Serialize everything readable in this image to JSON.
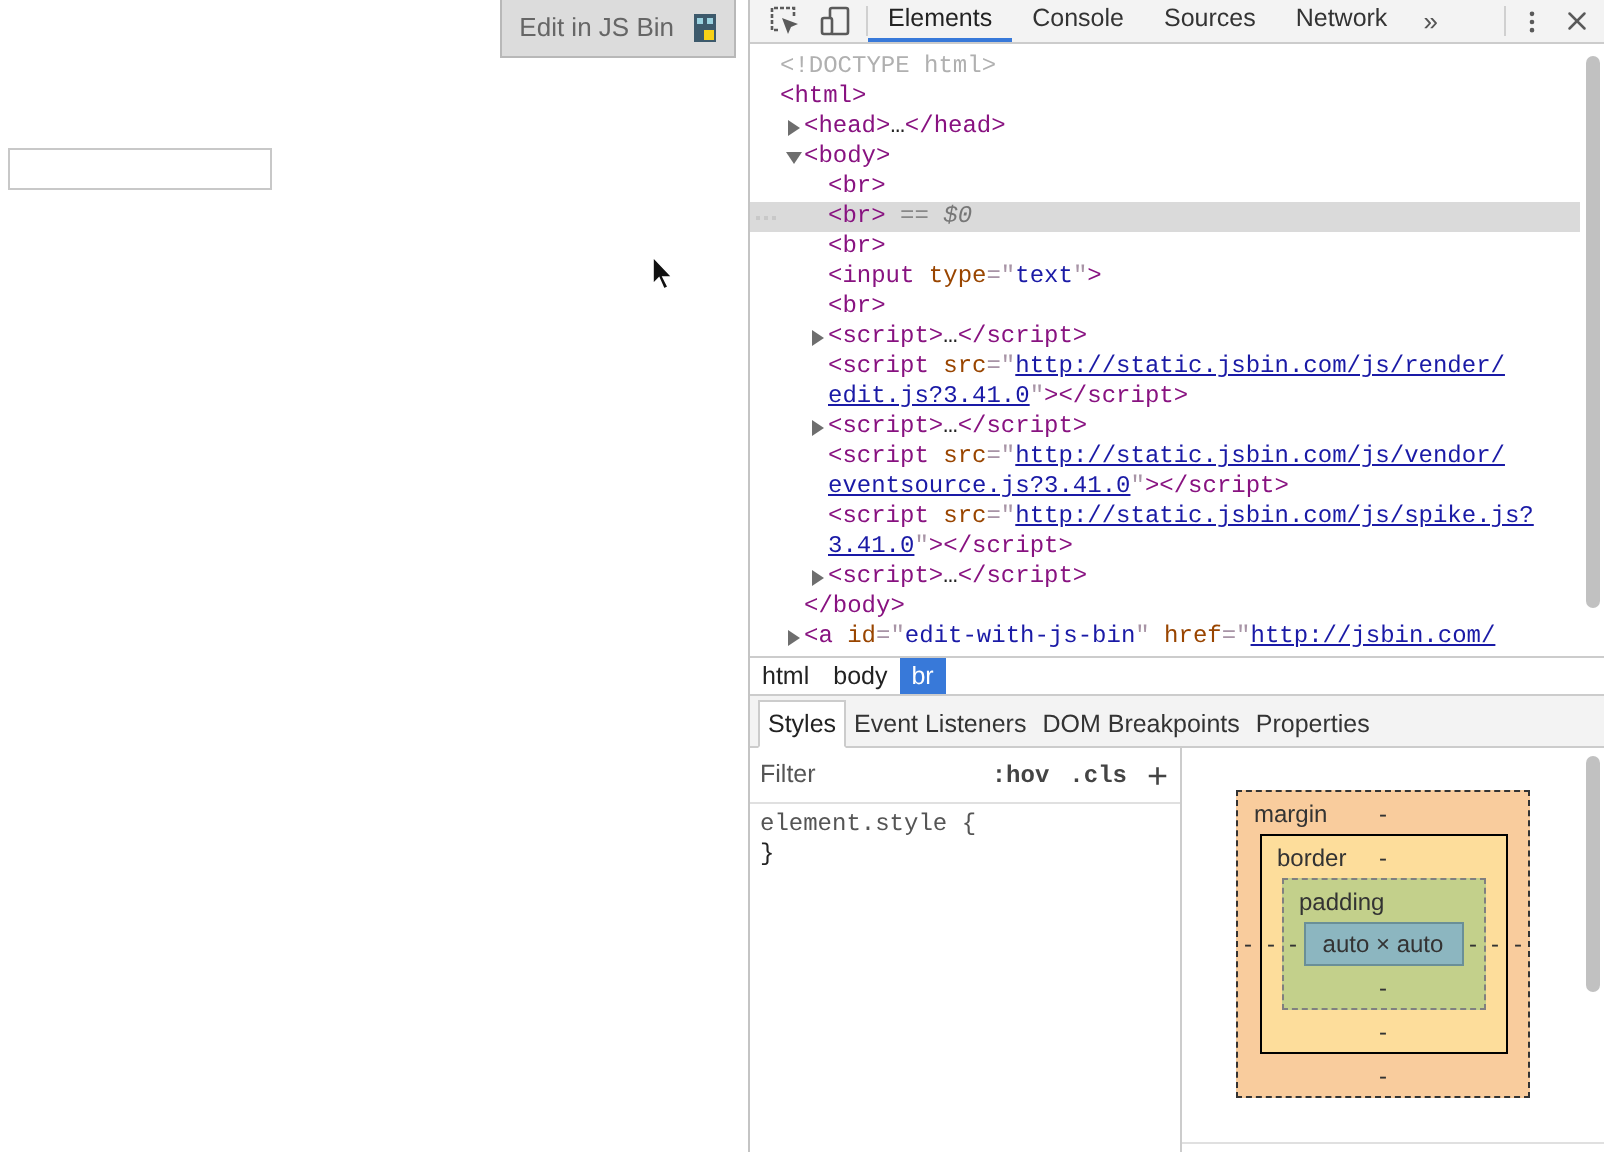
{
  "page": {
    "edit_button": "Edit in JS Bin"
  },
  "devtools": {
    "tabs": [
      {
        "label": "Elements",
        "selected": true
      },
      {
        "label": "Console",
        "selected": false
      },
      {
        "label": "Sources",
        "selected": false
      },
      {
        "label": "Network",
        "selected": false
      }
    ],
    "overflow": "»",
    "dom": [
      {
        "selected": false,
        "lines": [
          [
            {
              "kind": "doctype",
              "text": "<!DOCTYPE html>"
            }
          ]
        ]
      },
      {
        "selected": false,
        "lines": [
          [
            {
              "kind": "tag",
              "text": "<html>"
            }
          ]
        ],
        "children": [
          {
            "selected": false,
            "expanded": false,
            "lines": [
              [
                {
                  "kind": "tag",
                  "text": "<head>"
                },
                {
                  "kind": "text",
                  "text": "…"
                },
                {
                  "kind": "tag",
                  "text": "</head>"
                }
              ]
            ]
          },
          {
            "selected": false,
            "expanded": true,
            "lines": [
              [
                {
                  "kind": "tag",
                  "text": "<body>"
                }
              ]
            ],
            "closing": [
              {
                "kind": "tag",
                "text": "</body>"
              }
            ],
            "children": [
              {
                "selected": false,
                "lines": [
                  [
                    {
                      "kind": "tag",
                      "text": "<br>"
                    }
                  ]
                ]
              },
              {
                "selected": true,
                "lines": [
                  [
                    {
                      "kind": "tag",
                      "text": "<br>"
                    },
                    {
                      "kind": "op",
                      "text": " == "
                    },
                    {
                      "kind": "var",
                      "text": "$0"
                    }
                  ]
                ]
              },
              {
                "selected": false,
                "lines": [
                  [
                    {
                      "kind": "tag",
                      "text": "<br>"
                    }
                  ]
                ]
              },
              {
                "selected": false,
                "lines": [
                  [
                    {
                      "kind": "tag",
                      "text": "<input"
                    },
                    {
                      "kind": "attr",
                      "text": " type"
                    },
                    {
                      "kind": "punct",
                      "text": "=\""
                    },
                    {
                      "kind": "value",
                      "text": "text"
                    },
                    {
                      "kind": "punct",
                      "text": "\""
                    },
                    {
                      "kind": "tag",
                      "text": ">"
                    }
                  ]
                ]
              },
              {
                "selected": false,
                "lines": [
                  [
                    {
                      "kind": "tag",
                      "text": "<br>"
                    }
                  ]
                ]
              },
              {
                "selected": false,
                "expanded": false,
                "lines": [
                  [
                    {
                      "kind": "tag",
                      "text": "<script>"
                    },
                    {
                      "kind": "text",
                      "text": "…"
                    },
                    {
                      "kind": "tag",
                      "text": "</script>"
                    }
                  ]
                ]
              },
              {
                "selected": false,
                "lines": [
                  [
                    {
                      "kind": "tag",
                      "text": "<script"
                    },
                    {
                      "kind": "attr",
                      "text": " src"
                    },
                    {
                      "kind": "punct",
                      "text": "=\""
                    },
                    {
                      "kind": "link",
                      "text": "http://static.jsbin.com/js/render/"
                    }
                  ],
                  [
                    {
                      "kind": "link",
                      "text": "edit.js?3.41.0"
                    },
                    {
                      "kind": "punct",
                      "text": "\""
                    },
                    {
                      "kind": "tag",
                      "text": "></script>"
                    }
                  ]
                ]
              },
              {
                "selected": false,
                "expanded": false,
                "lines": [
                  [
                    {
                      "kind": "tag",
                      "text": "<script>"
                    },
                    {
                      "kind": "text",
                      "text": "…"
                    },
                    {
                      "kind": "tag",
                      "text": "</script>"
                    }
                  ]
                ]
              },
              {
                "selected": false,
                "lines": [
                  [
                    {
                      "kind": "tag",
                      "text": "<script"
                    },
                    {
                      "kind": "attr",
                      "text": " src"
                    },
                    {
                      "kind": "punct",
                      "text": "=\""
                    },
                    {
                      "kind": "link",
                      "text": "http://static.jsbin.com/js/vendor/"
                    }
                  ],
                  [
                    {
                      "kind": "link",
                      "text": "eventsource.js?3.41.0"
                    },
                    {
                      "kind": "punct",
                      "text": "\""
                    },
                    {
                      "kind": "tag",
                      "text": "></script>"
                    }
                  ]
                ]
              },
              {
                "selected": false,
                "lines": [
                  [
                    {
                      "kind": "tag",
                      "text": "<script"
                    },
                    {
                      "kind": "attr",
                      "text": " src"
                    },
                    {
                      "kind": "punct",
                      "text": "=\""
                    },
                    {
                      "kind": "link",
                      "text": "http://static.jsbin.com/js/spike.js?"
                    }
                  ],
                  [
                    {
                      "kind": "link",
                      "text": "3.41.0"
                    },
                    {
                      "kind": "punct",
                      "text": "\""
                    },
                    {
                      "kind": "tag",
                      "text": "></script>"
                    }
                  ]
                ]
              },
              {
                "selected": false,
                "expanded": false,
                "lines": [
                  [
                    {
                      "kind": "tag",
                      "text": "<script>"
                    },
                    {
                      "kind": "text",
                      "text": "…"
                    },
                    {
                      "kind": "tag",
                      "text": "</script>"
                    }
                  ]
                ]
              }
            ]
          },
          {
            "selected": false,
            "expanded": false,
            "lines": [
              [
                {
                  "kind": "tag",
                  "text": "<a"
                },
                {
                  "kind": "attr",
                  "text": " id"
                },
                {
                  "kind": "punct",
                  "text": "=\""
                },
                {
                  "kind": "value",
                  "text": "edit-with-js-bin"
                },
                {
                  "kind": "punct",
                  "text": "\""
                },
                {
                  "kind": "attr",
                  "text": " href"
                },
                {
                  "kind": "punct",
                  "text": "=\""
                },
                {
                  "kind": "link",
                  "text": "http://jsbin.com/"
                }
              ]
            ]
          }
        ]
      }
    ],
    "breadcrumbs": [
      {
        "label": "html",
        "selected": false
      },
      {
        "label": "body",
        "selected": false
      },
      {
        "label": "br",
        "selected": true
      }
    ],
    "sub_tabs": [
      {
        "label": "Styles",
        "selected": true
      },
      {
        "label": "Event Listeners",
        "selected": false
      },
      {
        "label": "DOM Breakpoints",
        "selected": false
      },
      {
        "label": "Properties",
        "selected": false
      }
    ],
    "styles": {
      "filter": {
        "placeholder": "Filter"
      },
      "hov": ":hov",
      "cls": ".cls",
      "add": "+",
      "rule_open": "element.style {",
      "rule_close": "}"
    },
    "box_model": {
      "margin": {
        "label": "margin",
        "top": "-",
        "right": "-",
        "bottom": "-",
        "left": "-"
      },
      "border": {
        "label": "border",
        "top": "-",
        "right": "-",
        "bottom": "-",
        "left": "-"
      },
      "padding": {
        "label": "padding",
        "right": "-",
        "bottom": "-",
        "left": "-"
      },
      "content": "auto × auto"
    }
  }
}
